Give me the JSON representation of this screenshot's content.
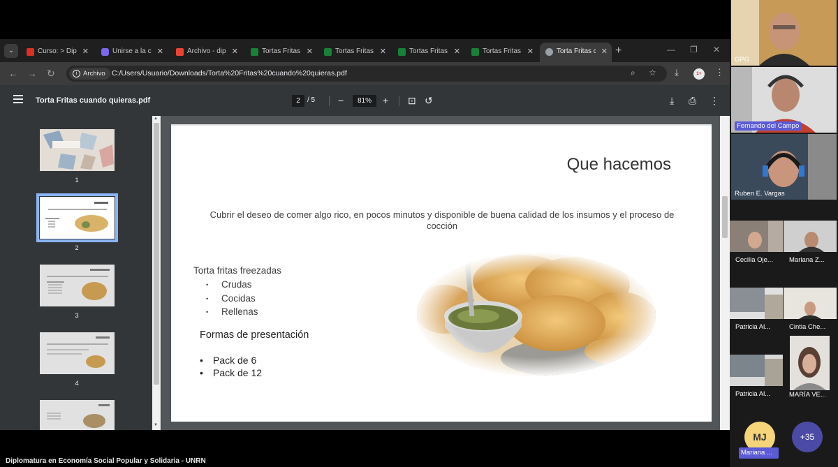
{
  "browser": {
    "tabs": [
      {
        "title": "Curso: > Dip",
        "favicon_color": "#d93025",
        "active": false
      },
      {
        "title": "Unirse a la c",
        "favicon_color": "#7b68ee",
        "active": false
      },
      {
        "title": "Archivo - dip",
        "favicon_color": "#ea4335",
        "active": false
      },
      {
        "title": "Tortas Fritas",
        "favicon_color": "#188038",
        "active": false
      },
      {
        "title": "Tortas Fritas",
        "favicon_color": "#188038",
        "active": false
      },
      {
        "title": "Tortas Fritas",
        "favicon_color": "#188038",
        "active": false
      },
      {
        "title": "Tortas Fritas",
        "favicon_color": "#188038",
        "active": false
      },
      {
        "title": "Torta Fritas c",
        "favicon_color": "#9aa0a6",
        "active": true
      }
    ],
    "new_tab": "+",
    "address": {
      "chip_label": "Archivo",
      "url": "C:/Users/Usuario/Downloads/Torta%20Fritas%20cuando%20quieras.pdf"
    },
    "profile_badge": "1+"
  },
  "pdf": {
    "file_name": "Torta Fritas cuando quieras.pdf",
    "current_page": "2",
    "total_pages": "/ 5",
    "zoom": "81%",
    "thumbnails": [
      "1",
      "2",
      "3",
      "4"
    ],
    "selected_page": "2"
  },
  "slide": {
    "title": "Que hacemos",
    "subtitle": "Cubrir el deseo de comer algo rico, en pocos minutos y disponible de buena calidad de los insumos y el proceso de cocción",
    "list_title": "Torta fritas freezadas",
    "list_items": [
      "Crudas",
      "Cocidas",
      "Rellenas"
    ],
    "forms_title": "Formas de presentación",
    "forms_items": [
      "Pack de 6",
      "Pack de 12"
    ]
  },
  "participants": {
    "large": [
      {
        "name": "GPG",
        "highlight": false
      },
      {
        "name": "Fernando del Campo",
        "highlight": true
      },
      {
        "name": "Ruben E. Vargas",
        "highlight": false
      }
    ],
    "small": [
      {
        "name": "Cecilia Oje..."
      },
      {
        "name": "Mariana Z..."
      },
      {
        "name": "Patricia Al..."
      },
      {
        "name": "Cintia Che..."
      },
      {
        "name": "Patricia Al..."
      },
      {
        "name": "MARÍA VE..."
      }
    ],
    "avatar_initials": "MJ",
    "avatar_name": "Mariana ...",
    "more_count": "+35"
  },
  "caption": "Diplomatura en Economía Social Popular y Solidaria - UNRN"
}
